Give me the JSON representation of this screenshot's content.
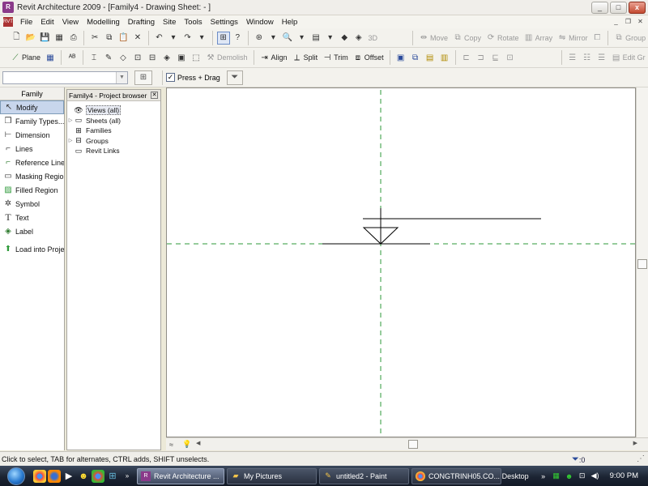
{
  "window": {
    "title": "Revit Architecture 2009 - [Family4 - Drawing Sheet: - ]",
    "controls": {
      "minimize": "_",
      "maximize": "□",
      "close": "x"
    }
  },
  "menu": [
    "File",
    "Edit",
    "View",
    "Modelling",
    "Drafting",
    "Site",
    "Tools",
    "Settings",
    "Window",
    "Help"
  ],
  "toolbar1": {
    "buttons": {
      "move": "Move",
      "copy": "Copy",
      "rotate": "Rotate",
      "array": "Array",
      "mirror": "Mirror",
      "group": "Group"
    },
    "three_d": "3D"
  },
  "toolbar2": {
    "plane": "Plane",
    "demolish": "Demolish",
    "align": "Align",
    "split": "Split",
    "trim": "Trim",
    "offset": "Offset",
    "edit": "Edit Gr"
  },
  "options_bar": {
    "type_selector_value": "",
    "press_drag_label": "Press + Drag",
    "press_drag_checked": true
  },
  "design_bar": {
    "tab": "Family",
    "items": [
      {
        "label": "Modify",
        "icon": "arrow-cursor-icon"
      },
      {
        "label": "Family Types...",
        "icon": "family-types-icon"
      },
      {
        "label": "Dimension",
        "icon": "dimension-icon"
      },
      {
        "label": "Lines",
        "icon": "lines-icon"
      },
      {
        "label": "Reference Lines",
        "icon": "reference-lines-icon"
      },
      {
        "label": "Masking Region",
        "icon": "masking-region-icon"
      },
      {
        "label": "Filled Region",
        "icon": "filled-region-icon"
      },
      {
        "label": "Symbol",
        "icon": "symbol-icon"
      },
      {
        "label": "Text",
        "icon": "text-icon"
      },
      {
        "label": "Label",
        "icon": "label-icon"
      },
      {
        "label": "Load into Project",
        "icon": "load-into-project-icon"
      }
    ]
  },
  "project_browser": {
    "title": "Family4 - Project browser",
    "items": [
      {
        "label": "Views (all)",
        "icon": "eye-icon"
      },
      {
        "label": "Sheets (all)",
        "icon": "sheet-icon"
      },
      {
        "label": "Families",
        "icon": "families-icon"
      },
      {
        "label": "Groups",
        "icon": "groups-icon"
      },
      {
        "label": "Revit Links",
        "icon": "link-icon"
      }
    ]
  },
  "status": {
    "text": "Click to select, TAB for alternates, CTRL adds, SHIFT unselects.",
    "filter_count": ":0"
  },
  "taskbar": {
    "tasks": [
      {
        "label": "Revit Architecture ...",
        "active": true
      },
      {
        "label": "My Pictures",
        "active": false
      },
      {
        "label": "untitled2 - Paint",
        "active": false
      },
      {
        "label": "CONGTRINH05.CO...",
        "active": false
      }
    ],
    "desktop": "Desktop",
    "clock": "9:00 PM"
  },
  "colors": {
    "reference_plane": "#2e9a3a",
    "accent": "#8a3a8a"
  }
}
